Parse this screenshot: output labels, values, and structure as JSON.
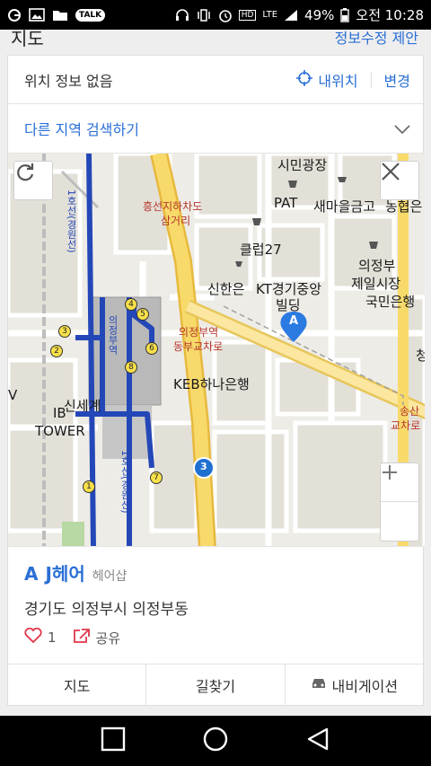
{
  "status": {
    "battery": "49%",
    "time": "오전 10:28",
    "network": "LTE",
    "talk_badge": "TALK",
    "hd_badge": "HD"
  },
  "header": {
    "title": "지도",
    "suggest_label": "정보수정 제안"
  },
  "location": {
    "status_text": "위치 정보 없음",
    "my_location_label": "내위치",
    "change_label": "변경"
  },
  "region_search": {
    "label": "다른 지역 검색하기"
  },
  "map": {
    "labels": {
      "plaza": "시민광장",
      "pat": "PAT",
      "saemaeul": "새마을금고",
      "nonghyup": "농협은",
      "heungseon1": "흥선지하차도",
      "heungseon2": "삼거리",
      "club": "클럽27",
      "shinhan": "신한은",
      "kgbld": "KT경기중앙",
      "kgbld2": "빌딩",
      "uijeongbu1": "의정부",
      "uijeongbu2": "제일시장",
      "kookmin": "국민은행",
      "stationjunc1": "의정부역",
      "stationjunc2": "동부교차로",
      "kebhana": "KEB하나은행",
      "shinsegae": "신세계",
      "ib": "IB",
      "tower": "TOWER",
      "songsan1": "송산",
      "songsan2": "교차로",
      "line1_a": "1호선(경원선)",
      "line1_b": "1호선(경원선)",
      "station_label": "의정부역",
      "road_number": "3",
      "pin_letter": "A",
      "cheong": "청",
      "v": "V"
    },
    "exits": [
      "1",
      "2",
      "3",
      "4",
      "5",
      "6",
      "7",
      "8"
    ]
  },
  "place": {
    "marker": "A",
    "name": "J헤어",
    "category": "헤어샵",
    "address": "경기도 의정부시 의정부동",
    "likes": "1",
    "share_label": "공유"
  },
  "tabs": {
    "map": "지도",
    "directions": "길찾기",
    "navigation": "내비게이션"
  },
  "colors": {
    "accent": "#2a6fd6",
    "subway_line": "#2447b8",
    "road_major": "#f5d24a",
    "like": "#e0364b"
  }
}
